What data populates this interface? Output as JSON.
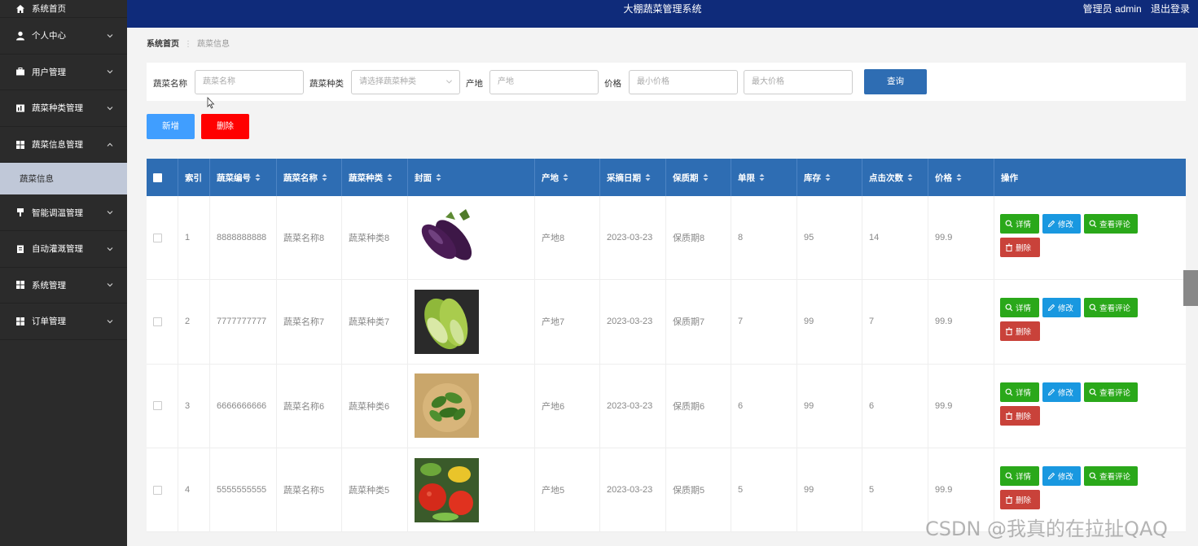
{
  "app": {
    "title": "大棚蔬菜管理系统",
    "user": "管理员 admin",
    "logout": "退出登录"
  },
  "sidebar": {
    "home": "系统首页",
    "items": [
      {
        "label": "个人中心",
        "icon": "person-icon"
      },
      {
        "label": "用户管理",
        "icon": "briefcase-icon"
      },
      {
        "label": "蔬菜种类管理",
        "icon": "chart-icon"
      },
      {
        "label": "蔬菜信息管理",
        "icon": "grid-icon",
        "expanded": true
      },
      {
        "label": "智能调温管理",
        "icon": "mic-icon"
      },
      {
        "label": "自动灌溉管理",
        "icon": "clipboard-icon"
      },
      {
        "label": "系统管理",
        "icon": "grid-icon"
      },
      {
        "label": "订单管理",
        "icon": "grid-icon"
      }
    ],
    "subitem": "蔬菜信息"
  },
  "breadcrumb": {
    "home": "系统首页",
    "current": "蔬菜信息"
  },
  "search": {
    "name_label": "蔬菜名称",
    "name_placeholder": "蔬菜名称",
    "type_label": "蔬菜种类",
    "type_placeholder": "请选择蔬菜种类",
    "origin_label": "产地",
    "origin_placeholder": "产地",
    "price_label": "价格",
    "min_placeholder": "最小价格",
    "max_placeholder": "最大价格",
    "query": "查询"
  },
  "actions": {
    "add": "新增",
    "delete": "删除"
  },
  "table": {
    "headers": [
      "索引",
      "蔬菜编号",
      "蔬菜名称",
      "蔬菜种类",
      "封面",
      "产地",
      "采摘日期",
      "保质期",
      "单限",
      "库存",
      "点击次数",
      "价格",
      "操作"
    ],
    "ops": {
      "detail": "详情",
      "edit": "修改",
      "review": "查看评论",
      "remove": "删除"
    },
    "rows": [
      {
        "index": "1",
        "code": "8888888888",
        "name": "蔬菜名称8",
        "type": "蔬菜种类8",
        "cover": "eggplant",
        "origin": "产地8",
        "date": "2023-03-23",
        "shelf": "保质期8",
        "limit": "8",
        "stock": "95",
        "clicks": "14",
        "price": "99.9"
      },
      {
        "index": "2",
        "code": "7777777777",
        "name": "蔬菜名称7",
        "type": "蔬菜种类7",
        "cover": "lettuce",
        "origin": "产地7",
        "date": "2023-03-23",
        "shelf": "保质期7",
        "limit": "7",
        "stock": "99",
        "clicks": "7",
        "price": "99.9"
      },
      {
        "index": "3",
        "code": "6666666666",
        "name": "蔬菜名称6",
        "type": "蔬菜种类6",
        "cover": "greens-bowl",
        "origin": "产地6",
        "date": "2023-03-23",
        "shelf": "保质期6",
        "limit": "6",
        "stock": "99",
        "clicks": "6",
        "price": "99.9"
      },
      {
        "index": "4",
        "code": "5555555555",
        "name": "蔬菜名称5",
        "type": "蔬菜种类5",
        "cover": "mixed-vegetables",
        "origin": "产地5",
        "date": "2023-03-23",
        "shelf": "保质期5",
        "limit": "5",
        "stock": "99",
        "clicks": "5",
        "price": "99.9"
      }
    ]
  },
  "watermark": "CSDN @我真的在拉扯QAQ",
  "colors": {
    "topbar": "#0f2b7a",
    "sidebar": "#2b2b2b",
    "table_header": "#2e6db3",
    "add": "#409eff",
    "delete": "#ff0000",
    "detail": "#2aa81a",
    "edit": "#1998e0",
    "remove": "#c9423a"
  }
}
